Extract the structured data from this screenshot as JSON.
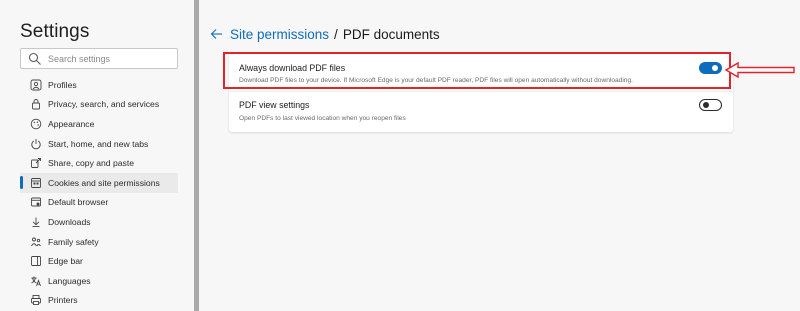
{
  "sidebar": {
    "title": "Settings",
    "search_placeholder": "Search settings",
    "items": [
      {
        "label": "Profiles",
        "icon": "profile-icon"
      },
      {
        "label": "Privacy, search, and services",
        "icon": "lock-icon"
      },
      {
        "label": "Appearance",
        "icon": "appearance-icon"
      },
      {
        "label": "Start, home, and new tabs",
        "icon": "power-icon"
      },
      {
        "label": "Share, copy and paste",
        "icon": "share-icon"
      },
      {
        "label": "Cookies and site permissions",
        "icon": "cookies-icon",
        "active": true
      },
      {
        "label": "Default browser",
        "icon": "browser-icon"
      },
      {
        "label": "Downloads",
        "icon": "download-icon"
      },
      {
        "label": "Family safety",
        "icon": "family-icon"
      },
      {
        "label": "Edge bar",
        "icon": "edge-bar-icon"
      },
      {
        "label": "Languages",
        "icon": "languages-icon"
      },
      {
        "label": "Printers",
        "icon": "printer-icon"
      }
    ]
  },
  "header": {
    "breadcrumb_parent": "Site permissions",
    "separator": "/",
    "breadcrumb_current": "PDF documents"
  },
  "settings": [
    {
      "title": "Always download PDF files",
      "description": "Download PDF files to your device. If Microsoft Edge is your default PDF reader, PDF files will open automatically without downloading.",
      "enabled": true
    },
    {
      "title": "PDF view settings",
      "description": "Open PDFs to last viewed location when you reopen files",
      "enabled": false
    }
  ],
  "colors": {
    "accent": "#0f6cbd",
    "annotation": "#e3222b"
  }
}
